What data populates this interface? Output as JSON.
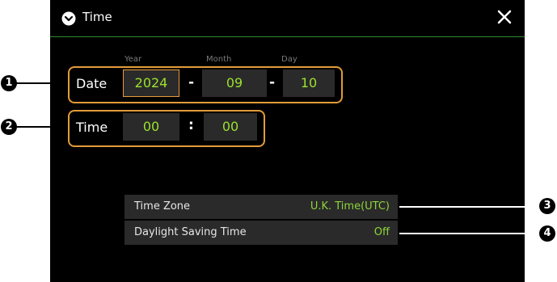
{
  "window": {
    "title": "Time",
    "title_icon": "chevron-down-circle-icon",
    "close_icon": "close-icon"
  },
  "date": {
    "label": "Date",
    "headers": {
      "year": "Year",
      "month": "Month",
      "day": "Day"
    },
    "year": "2024",
    "month": "09",
    "day": "10",
    "separator": "-"
  },
  "time": {
    "label": "Time",
    "hour": "00",
    "minute": "00",
    "separator": ":"
  },
  "settings": [
    {
      "label": "Time Zone",
      "value": "U.K. Time(UTC)"
    },
    {
      "label": "Daylight Saving Time",
      "value": "Off"
    }
  ],
  "callouts": [
    "1",
    "2",
    "3",
    "4"
  ],
  "colors": {
    "accent_green": "#9be22d",
    "highlight_orange": "#e39b3a",
    "title_line": "#2e8b2e",
    "field_bg": "#2a2a2a"
  }
}
